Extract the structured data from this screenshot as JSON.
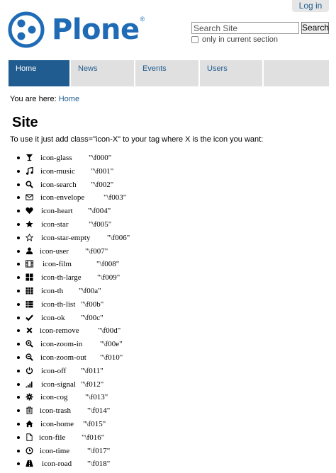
{
  "header": {
    "login_label": "Log in",
    "logo_text": "Plone",
    "logo_mark": "®",
    "search_placeholder": "Search Site",
    "search_button": "Search",
    "section_checkbox_label": "only in current section"
  },
  "nav": {
    "tabs": [
      {
        "label": "Home",
        "active": true
      },
      {
        "label": "News",
        "active": false
      },
      {
        "label": "Events",
        "active": false
      },
      {
        "label": "Users",
        "active": false
      },
      {
        "label": "",
        "active": false
      }
    ]
  },
  "breadcrumb": {
    "prefix": "You are here:",
    "home": "Home"
  },
  "main": {
    "title": "Site",
    "intro": "To use it just add class=\"icon-X\" to your tag where X is the icon you want:",
    "icons": [
      {
        "name": "icon-glass",
        "code": "\"\\f000\"",
        "icon": "glass-icon"
      },
      {
        "name": "icon-music",
        "code": "\"\\f001\"",
        "icon": "music-icon"
      },
      {
        "name": "icon-search",
        "code": "\"\\f002\"",
        "icon": "search-icon"
      },
      {
        "name": "icon-envelope",
        "code": "\"\\f003\"",
        "icon": "envelope-icon"
      },
      {
        "name": "icon-heart",
        "code": "\"\\f004\"",
        "icon": "heart-icon"
      },
      {
        "name": "icon-star",
        "code": "\"\\f005\"",
        "icon": "star-icon"
      },
      {
        "name": "icon-star-empty",
        "code": "\"\\f006\"",
        "icon": "star-empty-icon"
      },
      {
        "name": "icon-user",
        "code": "\"\\f007\"",
        "icon": "user-icon"
      },
      {
        "name": "icon-film",
        "code": "\"\\f008\"",
        "icon": "film-icon"
      },
      {
        "name": "icon-th-large",
        "code": "\"\\f009\"",
        "icon": "th-large-icon"
      },
      {
        "name": "icon-th",
        "code": "\"\\f00a\"",
        "icon": "th-icon"
      },
      {
        "name": "icon-th-list",
        "code": "\"\\f00b\"",
        "icon": "th-list-icon"
      },
      {
        "name": "icon-ok",
        "code": "\"\\f00c\"",
        "icon": "ok-icon"
      },
      {
        "name": "icon-remove",
        "code": "\"\\f00d\"",
        "icon": "remove-icon"
      },
      {
        "name": "icon-zoom-in",
        "code": "\"\\f00e\"",
        "icon": "zoom-in-icon"
      },
      {
        "name": "icon-zoom-out",
        "code": "\"\\f010\"",
        "icon": "zoom-out-icon"
      },
      {
        "name": "icon-off",
        "code": "\"\\f011\"",
        "icon": "off-icon"
      },
      {
        "name": "icon-signal",
        "code": "\"\\f012\"",
        "icon": "signal-icon"
      },
      {
        "name": "icon-cog",
        "code": "\"\\f013\"",
        "icon": "cog-icon"
      },
      {
        "name": "icon-trash",
        "code": "\"\\f014\"",
        "icon": "trash-icon"
      },
      {
        "name": "icon-home",
        "code": "\"\\f015\"",
        "icon": "home-icon"
      },
      {
        "name": "icon-file",
        "code": "\"\\f016\"",
        "icon": "file-icon"
      },
      {
        "name": "icon-time",
        "code": "\"\\f017\"",
        "icon": "time-icon"
      },
      {
        "name": "icon-road",
        "code": "\"\\f018\"",
        "icon": "road-icon"
      }
    ]
  },
  "colors": {
    "brand": "#1f6bb5",
    "link": "#205c90",
    "nav_active": "#205c90",
    "nav_inactive": "#e0e0e0"
  }
}
